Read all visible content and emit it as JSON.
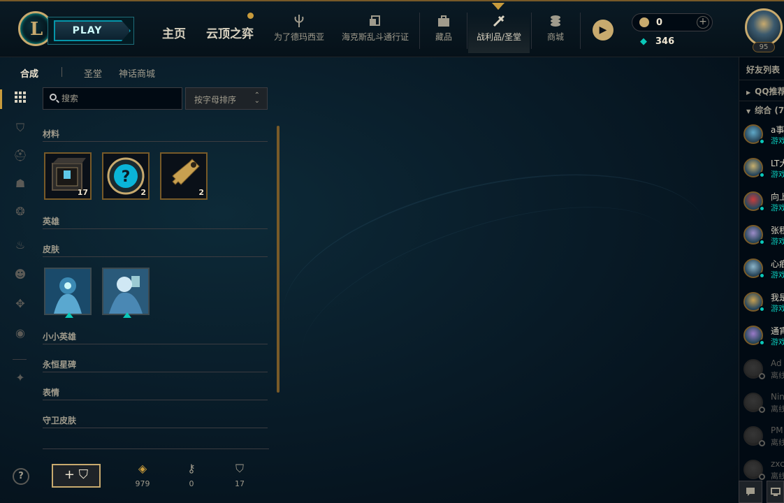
{
  "topbar": {
    "play_label": "PLAY",
    "nav_home": "主页",
    "nav_tft": "云顶之弈",
    "items": [
      {
        "label": "为了德玛西亚",
        "icon": "demacia-icon"
      },
      {
        "label": "海克斯乱斗通行证",
        "icon": "hextech-pass-icon"
      },
      {
        "label": "藏品",
        "icon": "collection-icon"
      },
      {
        "label": "战利品/圣堂",
        "icon": "loot-icon"
      },
      {
        "label": "商城",
        "icon": "store-icon"
      }
    ],
    "rp": "0",
    "be": "346",
    "level": "95"
  },
  "subtabs": {
    "craft": "合成",
    "sanctum": "圣堂",
    "mythic_shop": "神话商城"
  },
  "search": {
    "placeholder": "搜索"
  },
  "sort": {
    "label": "按字母排序"
  },
  "sections": {
    "materials": "材料",
    "champions": "英雄",
    "skins": "皮肤",
    "tacticians": "小小英雄",
    "eternals": "永恒星碑",
    "emotes": "表情",
    "ward_skins": "守卫皮肤"
  },
  "materials": [
    {
      "name": "hextech-chest",
      "count": "17"
    },
    {
      "name": "mystery-orb",
      "count": "2"
    },
    {
      "name": "key-fragment",
      "count": "2"
    }
  ],
  "footer": {
    "craft_label": "+ ⛉",
    "orange_essence": "979",
    "keys": "0",
    "chests": "17"
  },
  "friends": {
    "title": "好友列表",
    "group_qq": "QQ推荐",
    "group_general": "综合 (7",
    "list": [
      {
        "name": "a事",
        "status": "游戏",
        "online": true,
        "color": "#5fa8c8"
      },
      {
        "name": "LT大",
        "status": "游戏",
        "online": true,
        "color": "#c8b06e"
      },
      {
        "name": "向上",
        "status": "游戏",
        "online": true,
        "color": "#c83c3c"
      },
      {
        "name": "张程",
        "status": "游戏",
        "online": true,
        "color": "#9c8cc8"
      },
      {
        "name": "心痕",
        "status": "游戏",
        "online": true,
        "color": "#8cb4c8"
      },
      {
        "name": "我是",
        "status": "游戏",
        "online": true,
        "color": "#c8a050"
      },
      {
        "name": "通宵",
        "status": "游戏",
        "online": true,
        "color": "#9a7ac8"
      },
      {
        "name": "Ad",
        "status": "离线",
        "online": false,
        "color": "#5b5a56"
      },
      {
        "name": "Nin",
        "status": "离线",
        "online": false,
        "color": "#5b5a56"
      },
      {
        "name": "PM",
        "status": "离线",
        "online": false,
        "color": "#5b5a56"
      },
      {
        "name": "zxc",
        "status": "离线",
        "online": false,
        "color": "#5b5a56"
      }
    ]
  },
  "colors": {
    "gold": "#c8aa6e",
    "teal": "#0ac8b9",
    "bg": "#010a13"
  }
}
